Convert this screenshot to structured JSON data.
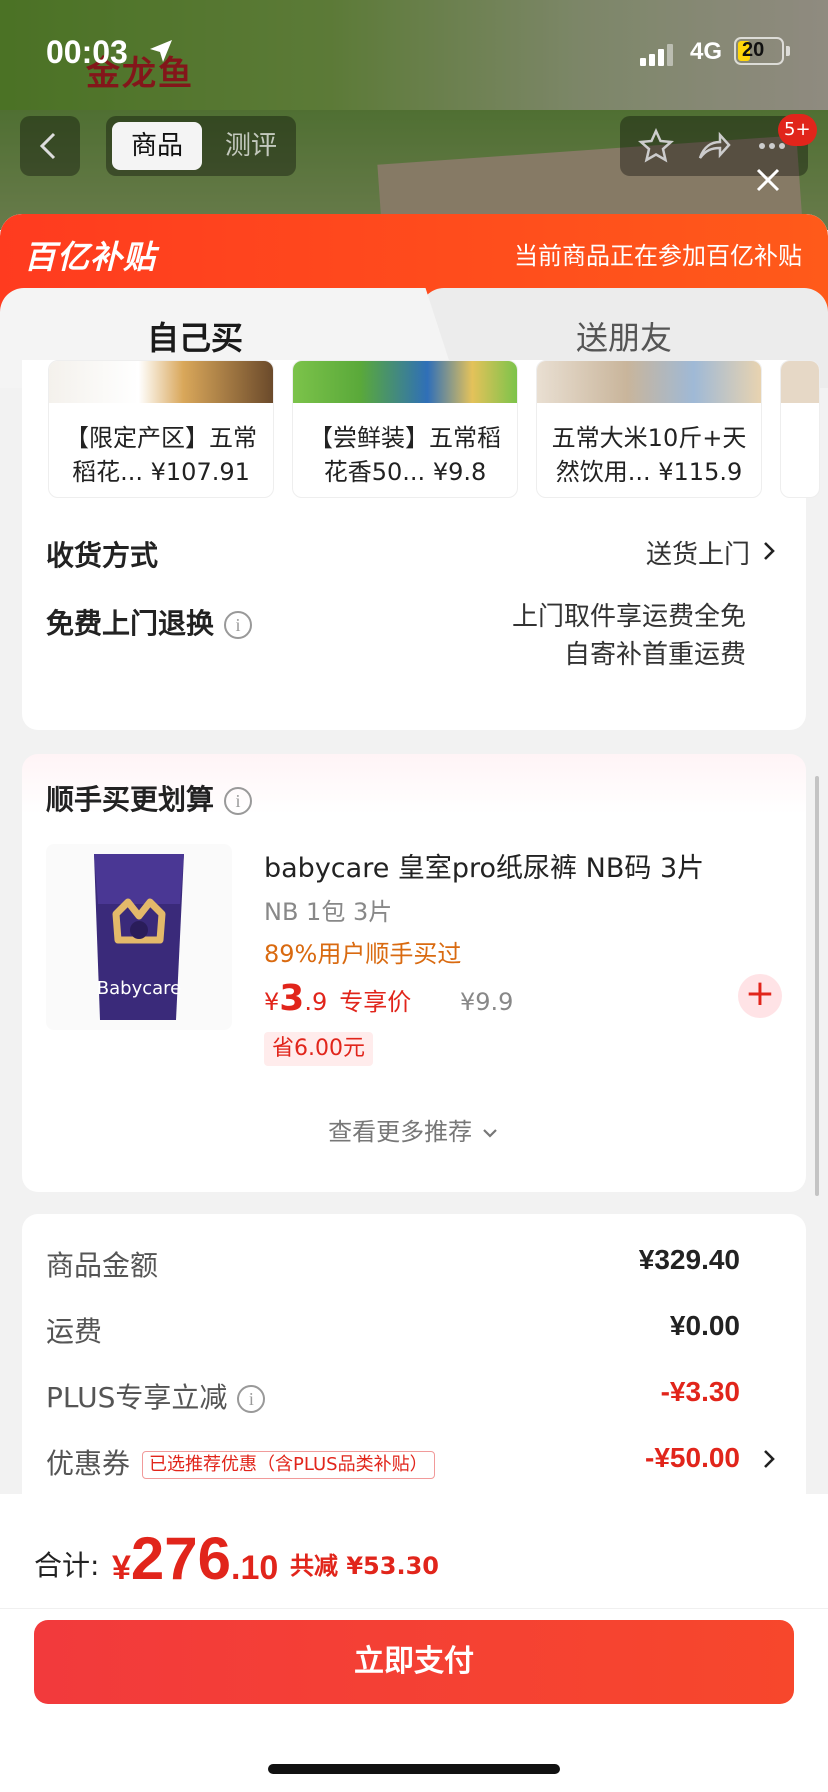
{
  "status": {
    "time": "00:03",
    "network": "4G",
    "battery": "20"
  },
  "background_page": {
    "brand": "金龙鱼",
    "nav_tabs": [
      {
        "label": "商品"
      },
      {
        "label": "测评"
      }
    ],
    "badge": "5+"
  },
  "subsidy": {
    "logo": "百亿补贴",
    "note": "当前商品正在参加百亿补贴"
  },
  "tabs": [
    {
      "label": "自己买"
    },
    {
      "label": "送朋友"
    }
  ],
  "recommended": [
    {
      "title": "【限定产区】五常稻花...",
      "price": "¥107.91"
    },
    {
      "title": "【尝鲜装】五常稻花香50...",
      "price": "¥9.8"
    },
    {
      "title": "五常大米10斤+天然饮用...",
      "price": "¥115.9"
    }
  ],
  "delivery": {
    "label": "收货方式",
    "value": "送货上门"
  },
  "returns": {
    "label": "免费上门退换",
    "line1": "上门取件享运费全免",
    "line2": "自寄补首重运费"
  },
  "addon": {
    "title": "顺手买更划算",
    "product": {
      "name": "babycare 皇室pro纸尿裤 NB码 3片",
      "spec": "NB 1包 3片",
      "buy_rate": "89%用户顺手买过",
      "price_symbol": "¥",
      "price_int": "3",
      "price_dec": ".9",
      "price_tag": "专享价",
      "orig_price": "¥9.9",
      "save": "省6.00元",
      "image_label": "Babycare"
    },
    "more": "查看更多推荐"
  },
  "fees": {
    "goods_label": "商品金额",
    "goods_value": "¥329.40",
    "shipping_label": "运费",
    "shipping_value": "¥0.00",
    "plus_label": "PLUS专享立减",
    "plus_value": "-¥3.30",
    "coupon_label": "优惠券",
    "coupon_tag": "已选推荐优惠（含PLUS品类补贴）",
    "coupon_value": "-¥50.00"
  },
  "footer": {
    "total_label": "合计:",
    "total_symbol": "¥",
    "total_int": "276",
    "total_dec": ".10",
    "discount": "共减 ¥53.30",
    "pay_label": "立即支付"
  },
  "colors": {
    "accent": "#e1251b",
    "subsidy_bar": "#ff4a1c",
    "pay_button": "#f23a3c"
  }
}
